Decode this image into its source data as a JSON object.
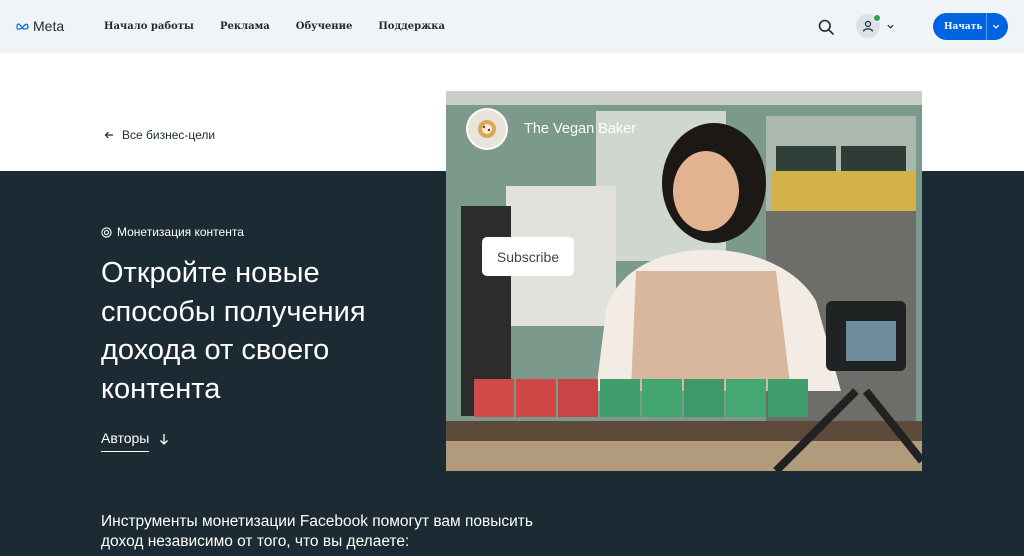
{
  "header": {
    "logo_text": "Meta",
    "nav": [
      {
        "label": "Начало работы"
      },
      {
        "label": "Реклама"
      },
      {
        "label": "Обучение"
      },
      {
        "label": "Поддержка"
      }
    ],
    "start_label": "Начать"
  },
  "back_link": "Все бизнес-цели",
  "tag_label": "Монетизация контента",
  "title": "Откройте новые способы получения дохода от своего контента",
  "authors_label": "Авторы",
  "body_text": "Инструменты монетизации Facebook помогут вам повысить доход независимо от того, что вы делаете:",
  "hero": {
    "channel_name": "The Vegan Baker",
    "subscribe_label": "Subscribe"
  },
  "colors": {
    "header_bg": "#f1f4f7",
    "dark_bg": "#1c2b33",
    "accent": "#0064e0",
    "online": "#31a24c"
  },
  "icons": [
    "meta-logo-icon",
    "search-icon",
    "user-icon",
    "chevron-down-icon",
    "arrow-left-icon",
    "target-icon",
    "arrow-down-icon"
  ]
}
